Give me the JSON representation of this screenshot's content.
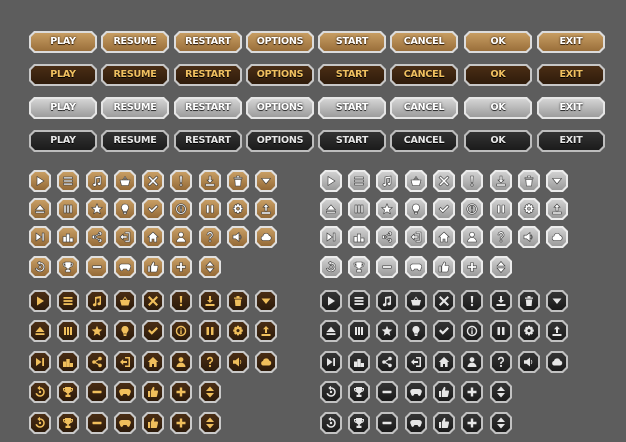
{
  "text_buttons": {
    "labels": [
      "PLAY",
      "RESUME",
      "RESTART",
      "OPTIONS",
      "START",
      "CANCEL",
      "OK",
      "EXIT"
    ],
    "styles": [
      "gold",
      "dark-brown",
      "silver",
      "black"
    ]
  },
  "icon_sets": {
    "styles": [
      "gold",
      "dark-brown",
      "silver",
      "black"
    ],
    "rows": [
      [
        "play-icon",
        "menu-icon",
        "music-icon",
        "shop-basket-icon",
        "close-icon",
        "exclamation-icon",
        "download-icon",
        "trash-icon",
        "chevron-down-icon"
      ],
      [
        "eject-icon",
        "pause-bars-icon",
        "star-icon",
        "lightbulb-icon",
        "checkmark-icon",
        "info-icon",
        "pause-icon",
        "gear-icon",
        "upload-icon"
      ],
      [
        "next-icon",
        "podium-icon",
        "share-icon",
        "exit-door-icon",
        "home-icon",
        "user-icon",
        "help-icon",
        "sound-icon",
        "cloud-icon"
      ],
      [
        "restart-icon",
        "trophy-icon",
        "minus-icon",
        "gamepad-icon",
        "thumbs-up-icon",
        "plus-icon",
        "expand-vertical-icon"
      ]
    ]
  },
  "colors": {
    "background": "#5d5d5d",
    "gold": "#b48650",
    "dark_brown": "#3a2410",
    "silver": "#b8b8b8",
    "black": "#242424",
    "brown_text": "#f0c060"
  }
}
